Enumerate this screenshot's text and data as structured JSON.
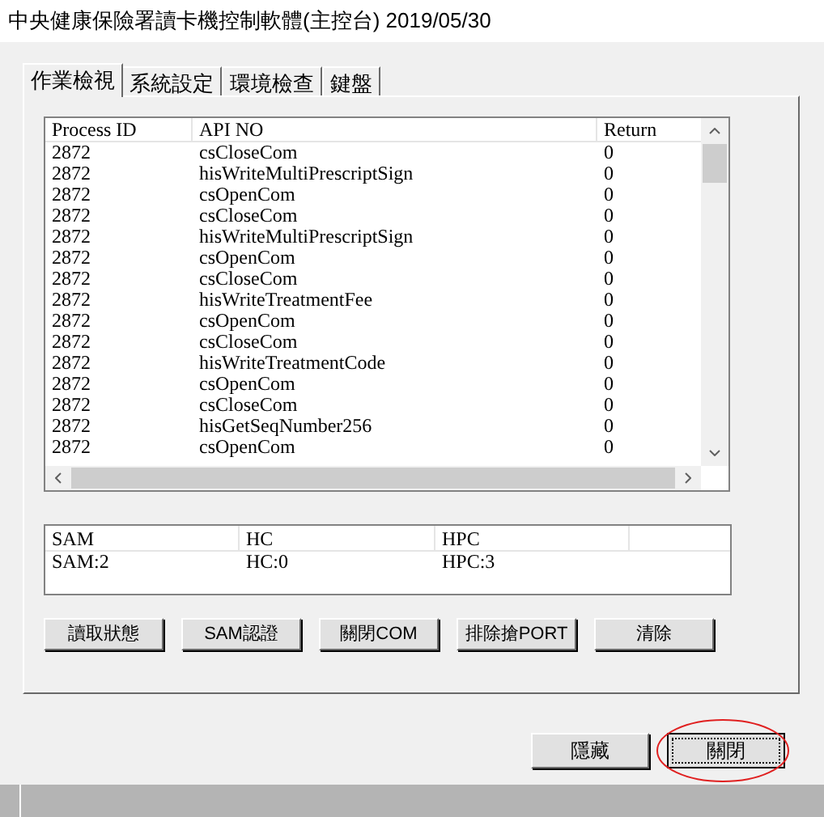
{
  "window": {
    "title": "中央健康保險署讀卡機控制軟體(主控台) 2019/05/30"
  },
  "tabs": [
    {
      "label": "作業檢視",
      "selected": true
    },
    {
      "label": "系統設定",
      "selected": false
    },
    {
      "label": "環境檢查",
      "selected": false
    },
    {
      "label": "鍵盤",
      "selected": false
    }
  ],
  "log_table": {
    "columns": [
      "Process ID",
      "API NO",
      "Return"
    ],
    "rows": [
      [
        "2872",
        "csCloseCom",
        "0"
      ],
      [
        "2872",
        "hisWriteMultiPrescriptSign",
        "0"
      ],
      [
        "2872",
        "csOpenCom",
        "0"
      ],
      [
        "2872",
        "csCloseCom",
        "0"
      ],
      [
        "2872",
        "hisWriteMultiPrescriptSign",
        "0"
      ],
      [
        "2872",
        "csOpenCom",
        "0"
      ],
      [
        "2872",
        "csCloseCom",
        "0"
      ],
      [
        "2872",
        "hisWriteTreatmentFee",
        "0"
      ],
      [
        "2872",
        "csOpenCom",
        "0"
      ],
      [
        "2872",
        "csCloseCom",
        "0"
      ],
      [
        "2872",
        "hisWriteTreatmentCode",
        "0"
      ],
      [
        "2872",
        "csOpenCom",
        "0"
      ],
      [
        "2872",
        "csCloseCom",
        "0"
      ],
      [
        "2872",
        "hisGetSeqNumber256",
        "0"
      ],
      [
        "2872",
        "csOpenCom",
        "0"
      ]
    ]
  },
  "status_table": {
    "columns": [
      "SAM",
      "HC",
      "HPC"
    ],
    "rows": [
      [
        "SAM:2",
        "HC:0",
        "HPC:3"
      ]
    ]
  },
  "action_buttons": [
    "讀取狀態",
    "SAM認證",
    "關閉COM",
    "排除搶PORT",
    "清除"
  ],
  "footer_buttons": [
    {
      "label": "隱藏",
      "focused": false
    },
    {
      "label": "關閉",
      "focused": true,
      "highlighted": true
    }
  ]
}
